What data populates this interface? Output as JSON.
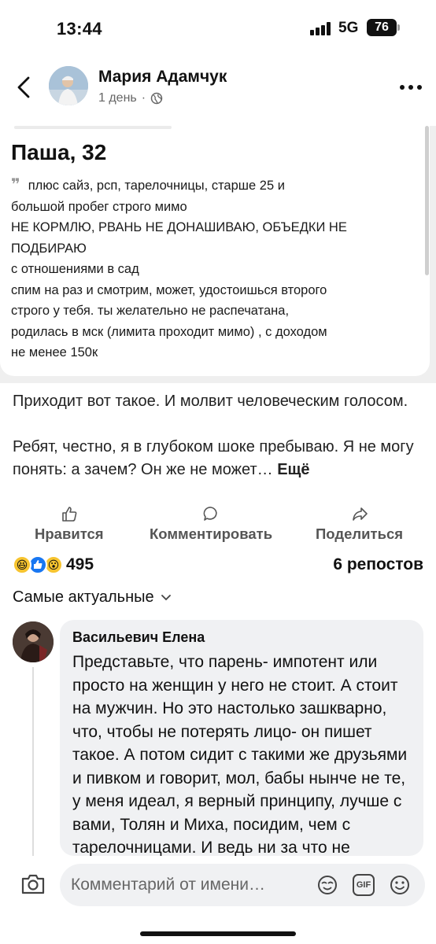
{
  "status": {
    "time": "13:44",
    "network": "5G",
    "battery": "76"
  },
  "header": {
    "author": "Мария Адамчук",
    "time_ago": "1 день",
    "dot": "·"
  },
  "post_image": {
    "title": "Паша, 32",
    "lines": [
      "плюс сайз, рсп, тарелочницы, старше 25 и",
      "большой пробег строго мимо",
      "НЕ КОРМЛЮ, РВАНЬ НЕ ДОНАШИВАЮ, ОБЪЕДКИ НЕ",
      "ПОДБИРАЮ",
      "с отношениями в сад",
      "спим на раз и смотрим, может, удостоишься второго",
      "строго у тебя. ты желательно не распечатана,",
      "родилась в мск (лимита проходит мимо) , с доходом",
      "не менее 150к"
    ]
  },
  "post": {
    "paragraph1": "Приходит вот такое.  И молвит человеческим голосом.",
    "paragraph2": "Ребят, честно, я в глубоком шоке пребываю.  Я не могу понять: а зачем? Он же не может…",
    "more": "Ещё"
  },
  "actions": {
    "like": "Нравится",
    "comment": "Комментировать",
    "share": "Поделиться"
  },
  "stats": {
    "reactions": "495",
    "reposts": "6 репостов"
  },
  "sort": {
    "label": "Самые актуальные"
  },
  "comment": {
    "name": "Васильевич Елена",
    "text": "Представьте, что парень- импотент или просто на женщин у него не стоит. А стоит на мужчин. Но это настолько зашкварно, что, чтобы не потерять лицо- он пишет такое. А потом сидит с такими же друзьями и пивком и говорит, мол, бабы нынче не те, у меня идеал, я верный принципу, лучше с вами, Толян и Миха, посидим, чем  с тарелочницами. И ведь ни за что не"
  },
  "composer": {
    "placeholder": "Комментарий от имени…",
    "gif": "GIF"
  }
}
